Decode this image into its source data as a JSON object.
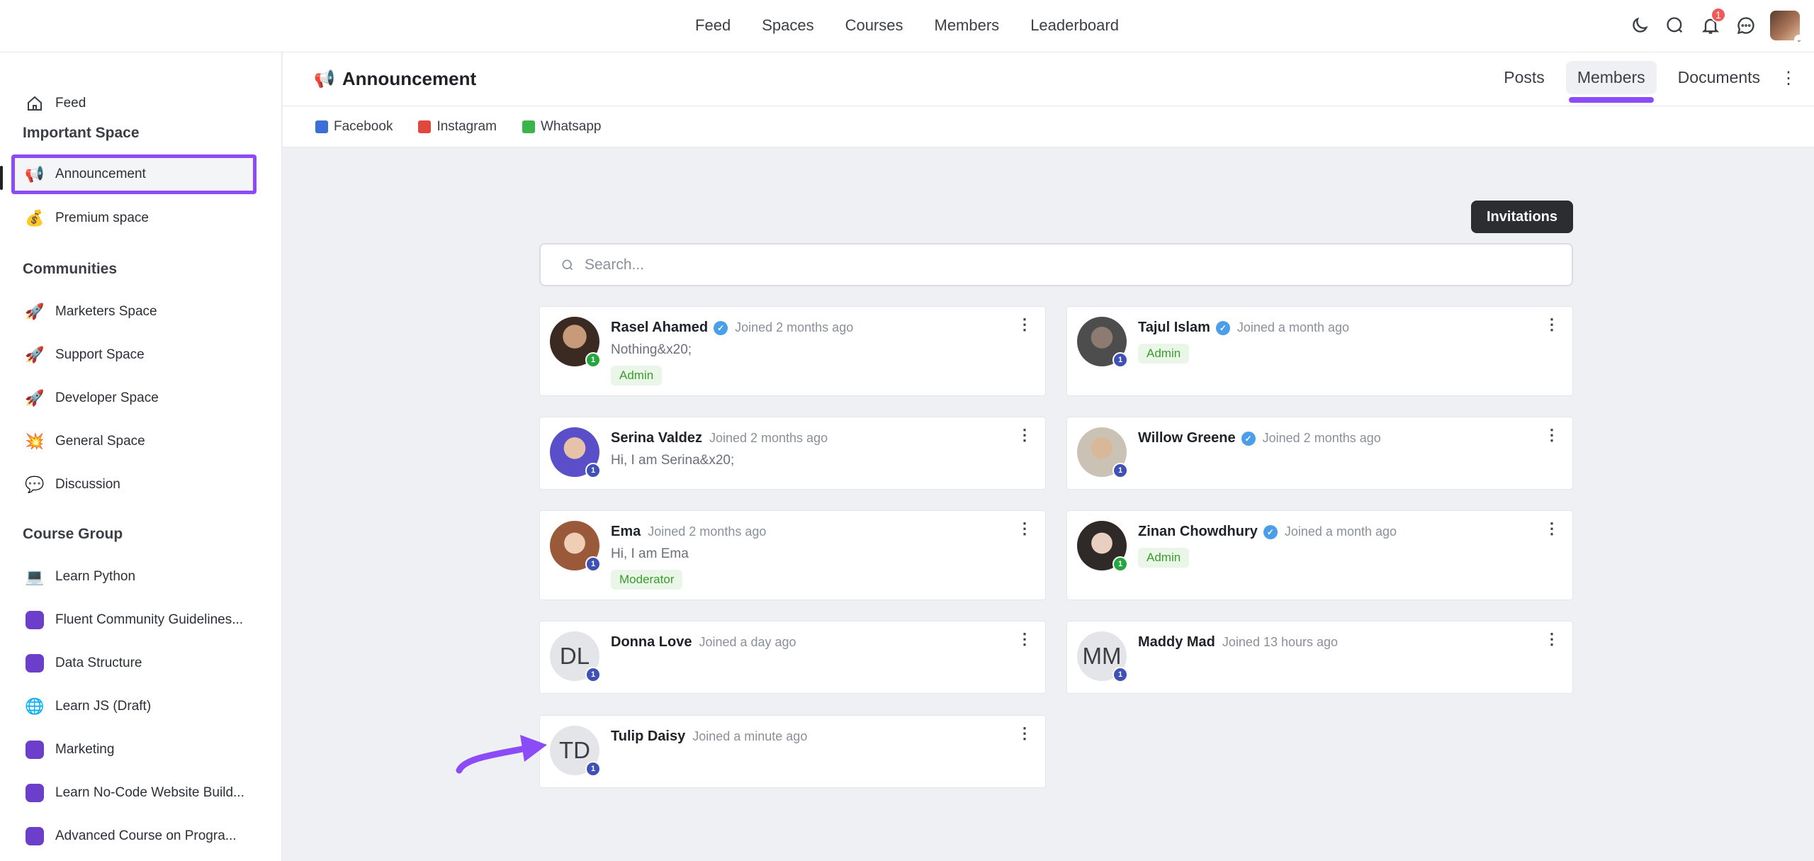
{
  "topnav": [
    "Feed",
    "Spaces",
    "Courses",
    "Members",
    "Leaderboard"
  ],
  "notifications_count": "1",
  "sidebar": {
    "feed": "Feed",
    "important_space_heading": "Important Space",
    "important": [
      {
        "label": "Announcement",
        "icon": "megaphone-icon",
        "glyph": "📢"
      },
      {
        "label": "Premium space",
        "icon": "money-bag-icon",
        "glyph": "💰"
      }
    ],
    "communities_heading": "Communities",
    "communities": [
      {
        "label": "Marketers Space",
        "icon": "rocket-icon",
        "glyph": "🚀"
      },
      {
        "label": "Support Space",
        "icon": "rocket-icon",
        "glyph": "🚀"
      },
      {
        "label": "Developer Space",
        "icon": "rocket-icon",
        "glyph": "🚀"
      },
      {
        "label": "General Space",
        "icon": "collision-icon",
        "glyph": "💥"
      },
      {
        "label": "Discussion",
        "icon": "speech-bubble-icon",
        "glyph": "💬"
      }
    ],
    "course_group_heading": "Course Group",
    "courses": [
      {
        "label": "Learn Python",
        "icon": "laptop-icon",
        "glyph": "💻"
      },
      {
        "label": "Fluent Community Guidelines...",
        "icon": "course-square-icon",
        "glyph": ""
      },
      {
        "label": "Data Structure",
        "icon": "course-square-icon",
        "glyph": ""
      },
      {
        "label": "Learn JS (Draft)",
        "icon": "globe-icon",
        "glyph": "🌐"
      },
      {
        "label": "Marketing",
        "icon": "course-square-icon",
        "glyph": ""
      },
      {
        "label": "Learn No-Code Website Build...",
        "icon": "course-square-icon",
        "glyph": ""
      },
      {
        "label": "Advanced Course on Progra...",
        "icon": "course-square-icon",
        "glyph": ""
      }
    ]
  },
  "space": {
    "title": "Announcement",
    "tabs": [
      "Posts",
      "Members",
      "Documents"
    ],
    "active_tab": "Members",
    "links": [
      {
        "label": "Facebook",
        "color": "#3b6fd6"
      },
      {
        "label": "Instagram",
        "color": "#e0483e"
      },
      {
        "label": "Whatsapp",
        "color": "#3bb54a"
      }
    ]
  },
  "members": {
    "invitations_label": "Invitations",
    "search_placeholder": "Search...",
    "list": [
      {
        "name": "Rasel Ahamed",
        "verified": true,
        "joined": "Joined 2 months ago",
        "bio": "Nothing&x20;",
        "role": "Admin",
        "level": "1",
        "level_color": "green",
        "initials": ""
      },
      {
        "name": "Tajul Islam",
        "verified": true,
        "joined": "Joined a month ago",
        "bio": "",
        "role": "Admin",
        "level": "1",
        "level_color": "blue",
        "initials": ""
      },
      {
        "name": "Serina Valdez",
        "verified": false,
        "joined": "Joined 2 months ago",
        "bio": "Hi, I am Serina&x20;",
        "role": "",
        "level": "1",
        "level_color": "blue",
        "initials": ""
      },
      {
        "name": "Willow Greene",
        "verified": true,
        "joined": "Joined 2 months ago",
        "bio": "",
        "role": "",
        "level": "1",
        "level_color": "blue",
        "initials": ""
      },
      {
        "name": "Ema",
        "verified": false,
        "joined": "Joined 2 months ago",
        "bio": "Hi, I am Ema",
        "role": "Moderator",
        "level": "1",
        "level_color": "blue",
        "initials": ""
      },
      {
        "name": "Zinan Chowdhury",
        "verified": true,
        "joined": "Joined a month ago",
        "bio": "",
        "role": "Admin",
        "level": "1",
        "level_color": "green",
        "initials": ""
      },
      {
        "name": "Donna Love",
        "verified": false,
        "joined": "Joined a day ago",
        "bio": "",
        "role": "",
        "level": "1",
        "level_color": "blue",
        "initials": "DL"
      },
      {
        "name": "Maddy Mad",
        "verified": false,
        "joined": "Joined 13 hours ago",
        "bio": "",
        "role": "",
        "level": "1",
        "level_color": "blue",
        "initials": "MM"
      },
      {
        "name": "Tulip Daisy",
        "verified": false,
        "joined": "Joined a minute ago",
        "bio": "",
        "role": "",
        "level": "1",
        "level_color": "blue",
        "initials": "TD"
      }
    ]
  }
}
